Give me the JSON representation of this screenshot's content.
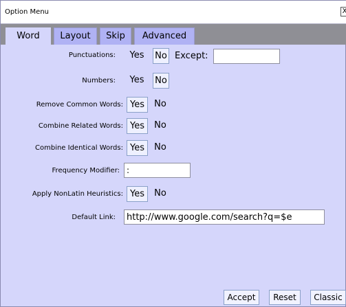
{
  "window": {
    "title": "Option Menu",
    "close_label": "X"
  },
  "tabs": [
    {
      "label": "Word",
      "active": true
    },
    {
      "label": "Layout",
      "active": false
    },
    {
      "label": "Skip",
      "active": false
    },
    {
      "label": "Advanced",
      "active": false
    }
  ],
  "options": {
    "punctuations": {
      "label": "Punctuations:",
      "yes": "Yes",
      "no": "No",
      "selected": "No",
      "except_label": "Except:",
      "except_value": ""
    },
    "numbers": {
      "label": "Numbers:",
      "yes": "Yes",
      "no": "No",
      "selected": "No"
    },
    "remove_common_words": {
      "label": "Remove Common Words:",
      "yes": "Yes",
      "no": "No",
      "selected": "Yes"
    },
    "combine_related_words": {
      "label": "Combine Related Words:",
      "yes": "Yes",
      "no": "No",
      "selected": "Yes"
    },
    "combine_identical_words": {
      "label": "Combine Identical Words:",
      "yes": "Yes",
      "no": "No",
      "selected": "Yes"
    },
    "frequency_modifier": {
      "label": "Frequency Modifier:",
      "value": ":"
    },
    "apply_nonlatin_heuristics": {
      "label": "Apply NonLatin Heuristics:",
      "yes": "Yes",
      "no": "No",
      "selected": "Yes"
    },
    "default_link": {
      "label": "Default Link:",
      "value": "http://www.google.com/search?q=$e"
    }
  },
  "buttons": {
    "accept": "Accept",
    "reset": "Reset",
    "classic": "Classic"
  }
}
